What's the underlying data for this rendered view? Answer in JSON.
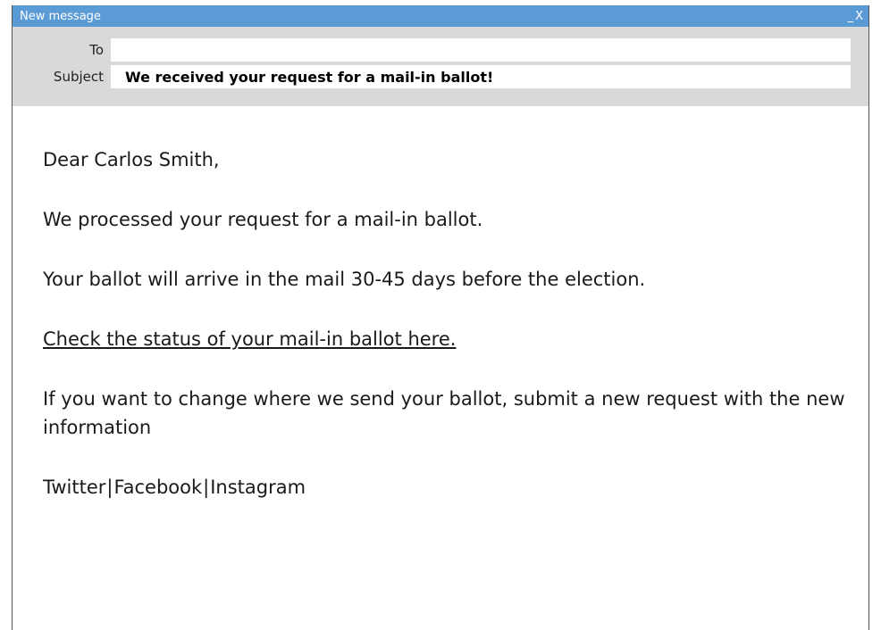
{
  "window": {
    "title": "New message",
    "minimize_label": "_",
    "close_label": "X"
  },
  "header": {
    "to_label": "To",
    "to_value": "",
    "subject_label": "Subject",
    "subject_value": "We received your request for a mail-in ballot!"
  },
  "body": {
    "greeting": "Dear Carlos Smith,",
    "line1": "We processed your request for a mail-in ballot.",
    "line2": "Your ballot will arrive in the mail 30-45 days before the election.",
    "status_link": "Check the status of your mail-in ballot here.",
    "line3": "If you want to change where we send your ballot, submit a new request with the new information"
  },
  "social": {
    "twitter": "Twitter",
    "separator": "|",
    "facebook": "Facebook",
    "instagram": "Instagram"
  },
  "colors": {
    "titlebar": "#5b9bd5",
    "header_bg": "#d9d9d9"
  }
}
